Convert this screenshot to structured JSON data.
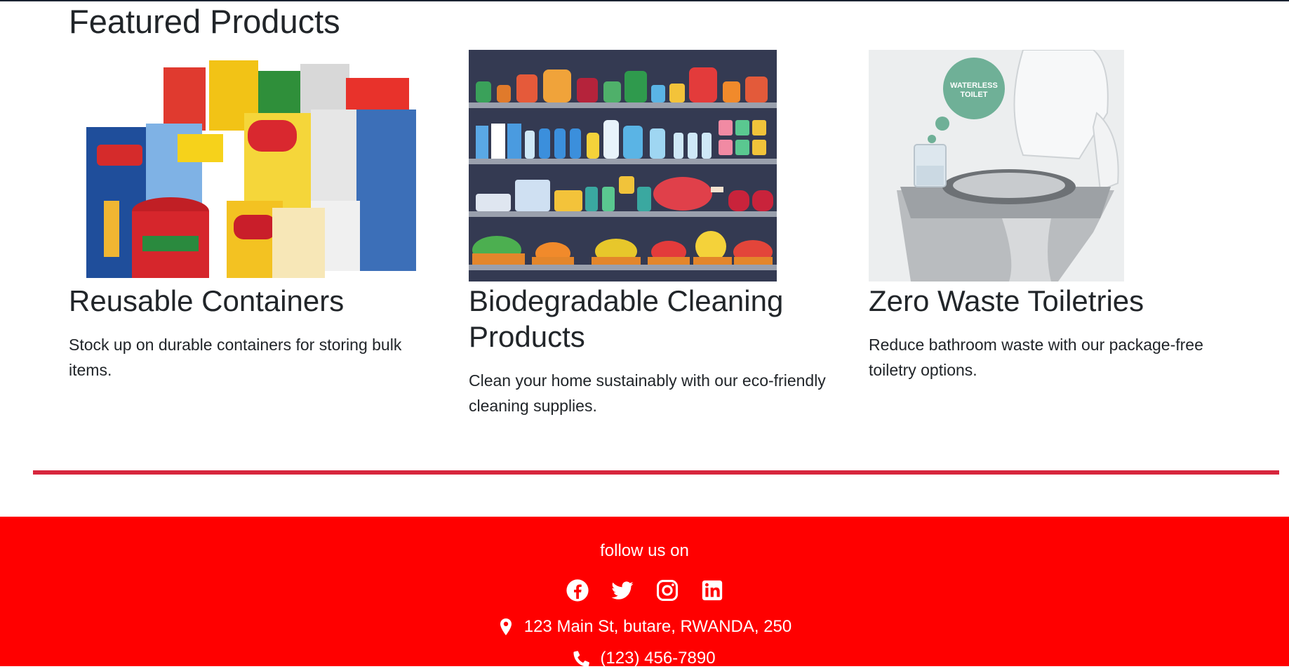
{
  "section": {
    "title": "Featured Products"
  },
  "products": [
    {
      "title": "Reusable Containers",
      "description": "Stock up on durable containers for storing bulk items.",
      "image_alt": "Packaged grocery products"
    },
    {
      "title": "Biodegradable Cleaning Products",
      "description": "Clean your home sustainably with our eco-friendly cleaning supplies.",
      "image_alt": "Illustrated store shelves with jars, bottles and produce"
    },
    {
      "title": "Zero Waste Toiletries",
      "description": "Reduce bathroom waste with our package-free toiletry options.",
      "image_alt": "Stainless steel waterless toilet",
      "image_badge": "WATERLESS TOILET"
    }
  ],
  "footer": {
    "follow_label": "follow us on",
    "socials": [
      "facebook-icon",
      "twitter-icon",
      "instagram-icon",
      "linkedin-icon"
    ],
    "address": "123 Main St, butare, RWANDA, 250",
    "phone": "(123) 456-7890"
  },
  "colors": {
    "footer_bg": "#ff0000",
    "divider": "#d7263d",
    "text": "#212529"
  }
}
